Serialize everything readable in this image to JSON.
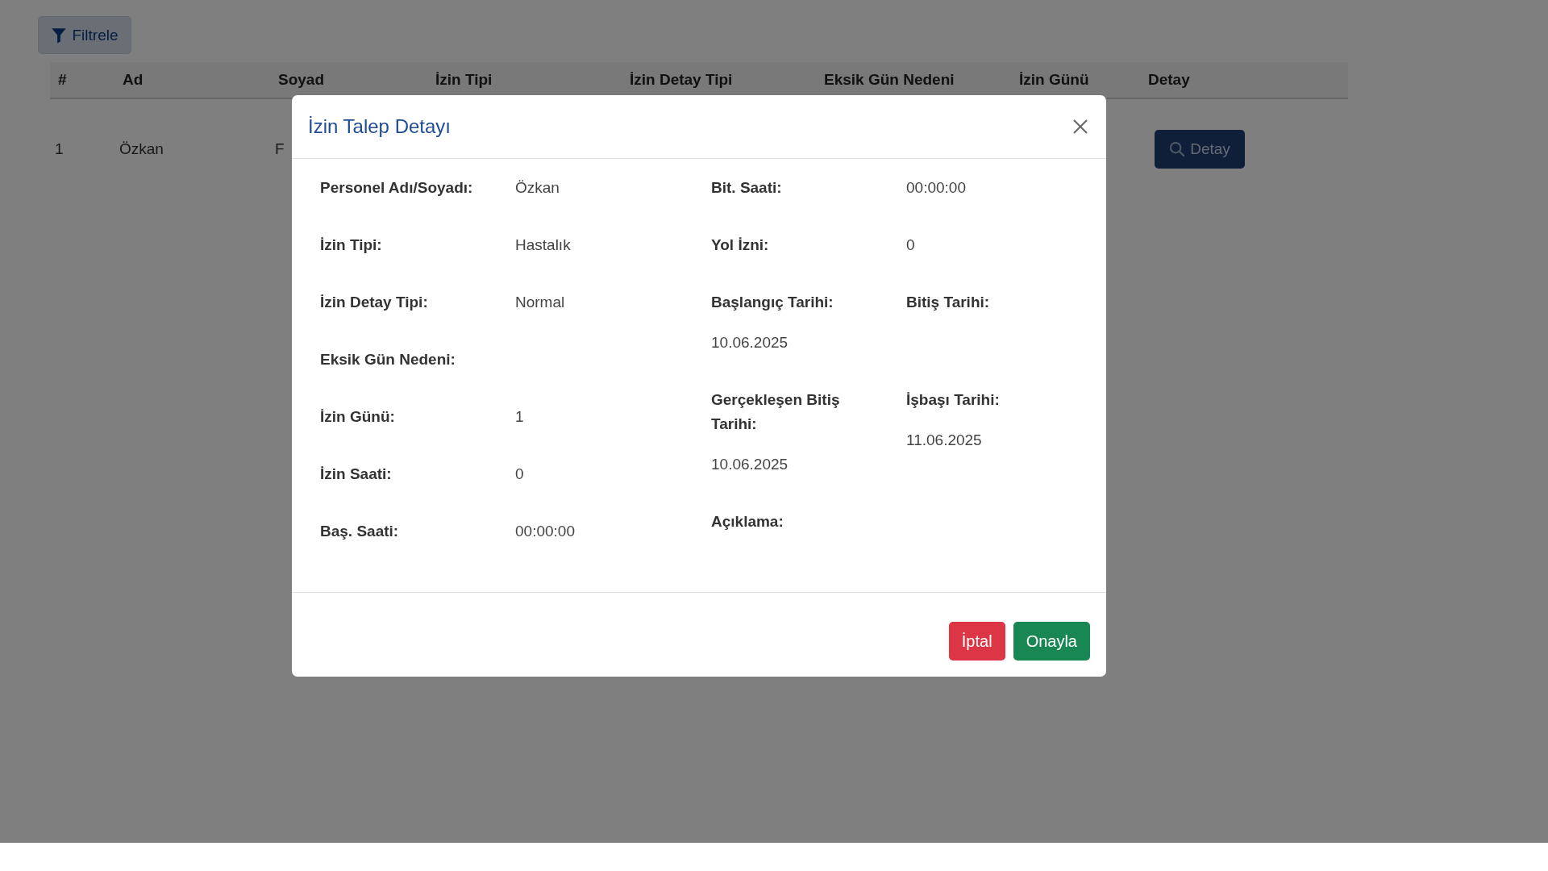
{
  "filter_button": {
    "label": "Filtrele"
  },
  "table": {
    "columns": [
      "#",
      "Ad",
      "Soyad",
      "İzin Tipi",
      "İzin Detay Tipi",
      "Eksik Gün Nedeni",
      "İzin Günü",
      "Detay"
    ],
    "rows": [
      {
        "cells": [
          "1",
          "Özkan",
          "F"
        ],
        "button": "Detay"
      }
    ]
  },
  "modal": {
    "title": "İzin Talep Detayı",
    "left_fields": [
      {
        "label": "Personel Adı/Soyadı:",
        "value": "Özkan"
      },
      {
        "label": "İzin Tipi:",
        "value": "Hastalık"
      },
      {
        "label": "İzin Detay Tipi:",
        "value": "Normal"
      },
      {
        "label": "Eksik Gün Nedeni:"
      },
      {
        "label": "İzin Günü:",
        "value": "1"
      },
      {
        "label": "İzin Saati:",
        "value": "0"
      },
      {
        "label": "Baş. Saati:",
        "value": "00:00:00"
      }
    ],
    "right_fields": [
      {
        "kind": "inline",
        "label": "Bit. Saati:",
        "value": "00:00:00"
      },
      {
        "kind": "inline",
        "label": "Yol İzni:",
        "value": "0"
      },
      {
        "kind": "stacked",
        "label": "Başlangıç Tarihi:",
        "value": "10.06.2025"
      },
      {
        "kind": "stacked",
        "label": "Bitiş Tarihi:"
      },
      {
        "kind": "stacked",
        "label": "Gerçekleşen Bitiş Tarihi:",
        "value": "10.06.2025"
      },
      {
        "kind": "stacked",
        "label": "İşbaşı Tarihi:",
        "value": "11.06.2025"
      },
      {
        "kind": "stacked",
        "label": "Açıklama:"
      }
    ],
    "buttons": [
      {
        "kind": "danger",
        "label": "İptal"
      },
      {
        "kind": "success",
        "label": "Onayla"
      }
    ]
  }
}
